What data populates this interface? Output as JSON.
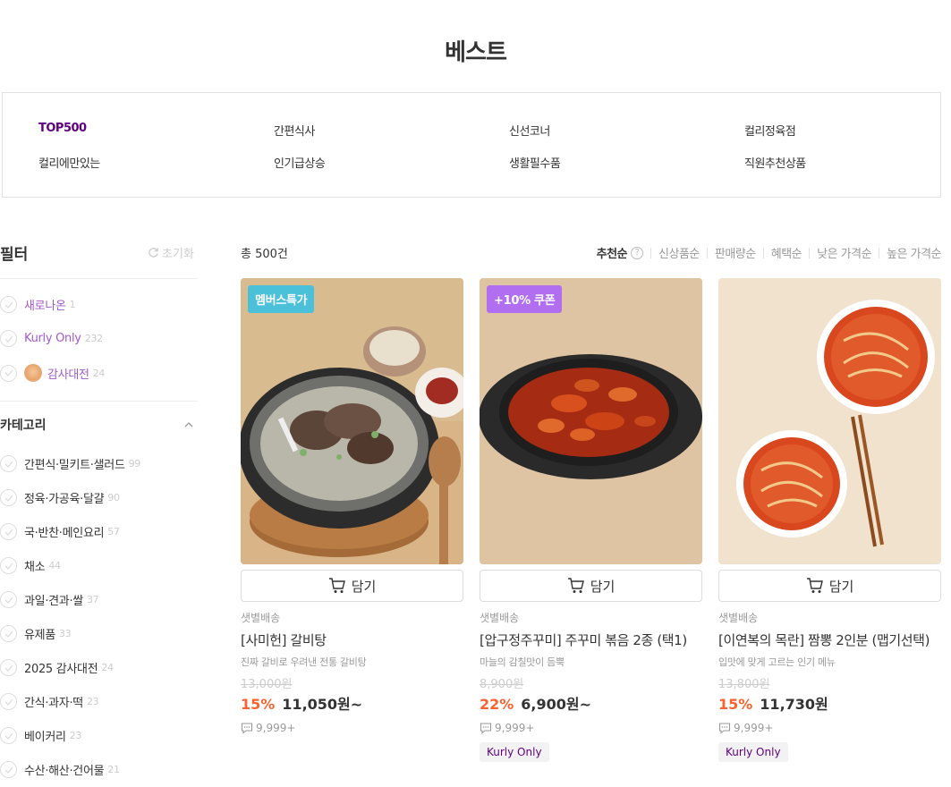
{
  "page": {
    "title": "베스트"
  },
  "categories": [
    {
      "label": "TOP500",
      "active": true
    },
    {
      "label": "간편식사"
    },
    {
      "label": "신선코너"
    },
    {
      "label": "컬리정육점"
    },
    {
      "label": "컬리에만있는"
    },
    {
      "label": "인기급상승"
    },
    {
      "label": "생활필수품"
    },
    {
      "label": "직원추천상품"
    }
  ],
  "filter": {
    "title": "필터",
    "reset_label": "초기화",
    "quick": [
      {
        "label": "새로나온",
        "count": "1"
      },
      {
        "label": "Kurly Only",
        "count": "232"
      },
      {
        "label": "감사대전",
        "count": "24"
      }
    ],
    "category_title": "카테고리",
    "category_items": [
      {
        "label": "간편식·밀키트·샐러드",
        "count": "99"
      },
      {
        "label": "정육·가공육·달걀",
        "count": "90"
      },
      {
        "label": "국·반찬·메인요리",
        "count": "57"
      },
      {
        "label": "채소",
        "count": "44"
      },
      {
        "label": "과일·견과·쌀",
        "count": "37"
      },
      {
        "label": "유제품",
        "count": "33"
      },
      {
        "label": "2025 감사대전",
        "count": "24"
      },
      {
        "label": "간식·과자·떡",
        "count": "23"
      },
      {
        "label": "베이커리",
        "count": "23"
      },
      {
        "label": "수산·해산·건어물",
        "count": "21"
      }
    ]
  },
  "list": {
    "total": "총 500건",
    "sorts": [
      "추천순",
      "신상품순",
      "판매량순",
      "혜택순",
      "낮은 가격순",
      "높은 가격순"
    ],
    "active_sort": "추천순"
  },
  "products": [
    {
      "tag": "멤버스특가",
      "tag_color": "#4bc0d9",
      "cart_label": "담기",
      "shipping": "샛별배송",
      "name": "[사미헌] 갈비탕",
      "desc": "진짜 갈비로 우려낸 전통 갈비탕",
      "original_price": "13,000원",
      "discount": "15%",
      "price": "11,050원~",
      "reviews": "9,999+",
      "kurly_only": null
    },
    {
      "tag": "+10% 쿠폰",
      "tag_color": "#b26ef0",
      "cart_label": "담기",
      "shipping": "샛별배송",
      "name": "[압구정주꾸미] 주꾸미 볶음 2종 (택1)",
      "desc": "마늘의 감칠맛이 듬뿍",
      "original_price": "8,900원",
      "discount": "22%",
      "price": "6,900원~",
      "reviews": "9,999+",
      "kurly_only": "Kurly Only"
    },
    {
      "tag": null,
      "tag_color": null,
      "cart_label": "담기",
      "shipping": "샛별배송",
      "name": "[이연복의 목란] 짬뽕 2인분 (맵기선택)",
      "desc": "입맛에 맞게 고르는 인기 메뉴",
      "original_price": "13,800원",
      "discount": "15%",
      "price": "11,730원",
      "reviews": "9,999+",
      "kurly_only": "Kurly Only"
    }
  ]
}
